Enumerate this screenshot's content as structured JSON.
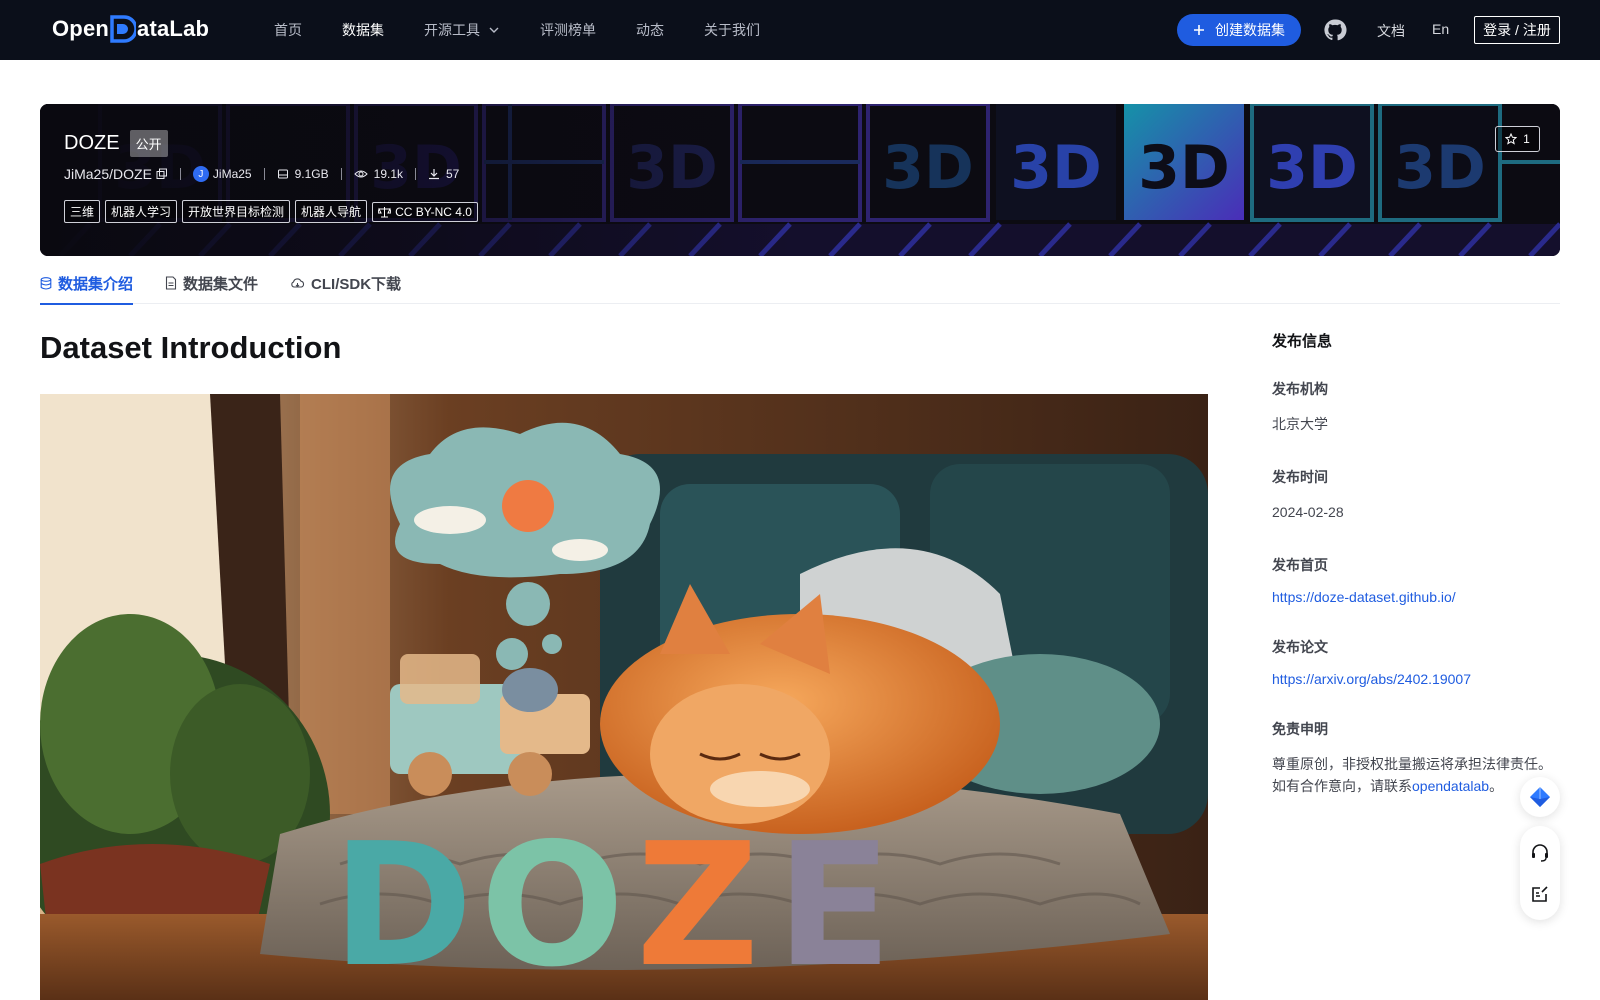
{
  "nav": {
    "logo_left": "Open",
    "logo_right": "ataLab",
    "items": [
      {
        "label": "首页"
      },
      {
        "label": "数据集"
      },
      {
        "label": "开源工具"
      },
      {
        "label": "评测榜单"
      },
      {
        "label": "动态"
      },
      {
        "label": "关于我们"
      }
    ],
    "create_label": "创建数据集",
    "docs_label": "文档",
    "lang_label": "En",
    "login_label": "登录 / 注册"
  },
  "dataset": {
    "name": "DOZE",
    "visibility": "公开",
    "path": "JiMa25/DOZE",
    "owner_initial": "J",
    "owner": "JiMa25",
    "size": "9.1GB",
    "views": "19.1k",
    "downloads": "57",
    "tags": [
      "三维",
      "机器人学习",
      "开放世界目标检测",
      "机器人导航"
    ],
    "license": "CC BY-NC 4.0",
    "stars": "1"
  },
  "tabs": [
    {
      "label": "数据集介绍"
    },
    {
      "label": "数据集文件"
    },
    {
      "label": "CLI/SDK下载"
    }
  ],
  "content": {
    "heading": "Dataset Introduction",
    "hero_word": "DOZE"
  },
  "sidebar": {
    "title": "发布信息",
    "org_label": "发布机构",
    "org_value": "北京大学",
    "date_label": "发布时间",
    "date_value": "2024-02-28",
    "homepage_label": "发布首页",
    "homepage_value": "https://doze-dataset.github.io/",
    "paper_label": "发布论文",
    "paper_value": "https://arxiv.org/abs/2402.19007",
    "disclaimer_label": "免责申明",
    "disclaimer_line1": "尊重原创，非授权批量搬运将承担法律责任。",
    "disclaimer_line2_prefix": "如有合作意向，请联系",
    "disclaimer_link": "opendatalab",
    "disclaimer_suffix": "。"
  },
  "colors": {
    "nav_bg": "#0b0f1a",
    "primary": "#1f5ce0",
    "banner_bg": "#0c0b12"
  },
  "icons": [
    "chevron-down-icon",
    "plus-icon",
    "github-icon",
    "copy-icon",
    "database-icon",
    "eye-icon",
    "download-icon",
    "scale-icon",
    "star-icon",
    "file-icon",
    "cloud-icon",
    "paper-plane-icon",
    "headset-icon",
    "edit-icon"
  ]
}
